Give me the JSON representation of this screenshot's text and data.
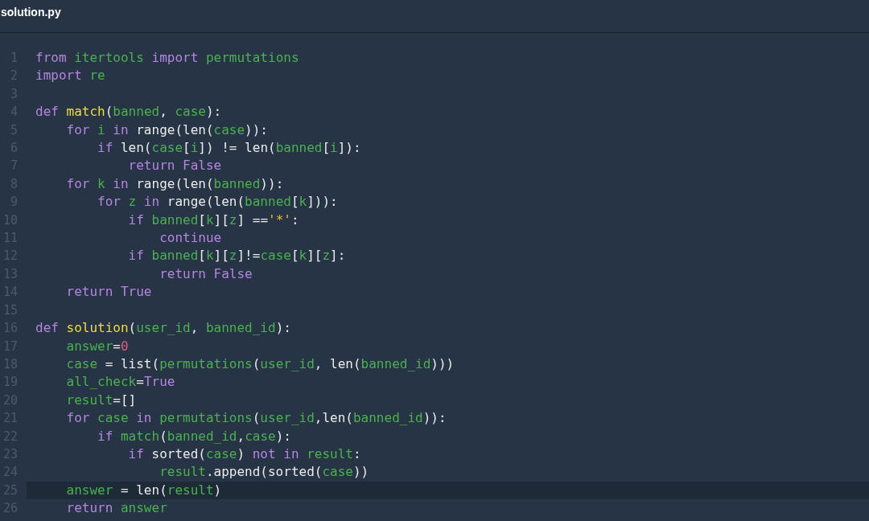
{
  "file": {
    "title": "solution.py"
  },
  "lines": [
    {
      "number": "1",
      "active": false,
      "tokens": [
        {
          "kind": "kw",
          "text": "from "
        },
        {
          "kind": "id",
          "text": "itertools"
        },
        {
          "kind": "kw",
          "text": " import "
        },
        {
          "kind": "id",
          "text": "permutations"
        }
      ]
    },
    {
      "number": "2",
      "active": false,
      "tokens": [
        {
          "kind": "kw",
          "text": "import "
        },
        {
          "kind": "id",
          "text": "re"
        }
      ]
    },
    {
      "number": "3",
      "active": false
    },
    {
      "number": "4",
      "active": false,
      "tokens": [
        {
          "kind": "kw",
          "text": "def "
        },
        {
          "kind": "fn",
          "text": "match"
        },
        {
          "kind": "plain",
          "text": "("
        },
        {
          "kind": "id",
          "text": "banned"
        },
        {
          "kind": "plain",
          "text": ", "
        },
        {
          "kind": "id",
          "text": "case"
        },
        {
          "kind": "plain",
          "text": "):"
        }
      ]
    },
    {
      "number": "5",
      "active": false,
      "tokens": [
        {
          "kind": "kw",
          "text": "    for "
        },
        {
          "kind": "id",
          "text": "i"
        },
        {
          "kind": "kw",
          "text": " in "
        },
        {
          "kind": "plain",
          "text": "range(len("
        },
        {
          "kind": "id",
          "text": "case"
        },
        {
          "kind": "plain",
          "text": ")):"
        }
      ]
    },
    {
      "number": "6",
      "active": false,
      "tokens": [
        {
          "kind": "kw",
          "text": "        if "
        },
        {
          "kind": "plain",
          "text": "len("
        },
        {
          "kind": "id",
          "text": "case"
        },
        {
          "kind": "plain",
          "text": "["
        },
        {
          "kind": "id",
          "text": "i"
        },
        {
          "kind": "plain",
          "text": "]) != len("
        },
        {
          "kind": "id",
          "text": "banned"
        },
        {
          "kind": "plain",
          "text": "["
        },
        {
          "kind": "id",
          "text": "i"
        },
        {
          "kind": "plain",
          "text": "]):"
        }
      ]
    },
    {
      "number": "7",
      "active": false,
      "tokens": [
        {
          "kind": "kw",
          "text": "            return False"
        }
      ]
    },
    {
      "number": "8",
      "active": false,
      "tokens": [
        {
          "kind": "kw",
          "text": "    for "
        },
        {
          "kind": "id",
          "text": "k"
        },
        {
          "kind": "kw",
          "text": " in "
        },
        {
          "kind": "plain",
          "text": "range(len("
        },
        {
          "kind": "id",
          "text": "banned"
        },
        {
          "kind": "plain",
          "text": ")):"
        }
      ]
    },
    {
      "number": "9",
      "active": false,
      "tokens": [
        {
          "kind": "kw",
          "text": "        for "
        },
        {
          "kind": "id",
          "text": "z"
        },
        {
          "kind": "kw",
          "text": " in "
        },
        {
          "kind": "plain",
          "text": "range(len("
        },
        {
          "kind": "id",
          "text": "banned"
        },
        {
          "kind": "plain",
          "text": "["
        },
        {
          "kind": "id",
          "text": "k"
        },
        {
          "kind": "plain",
          "text": "])):"
        }
      ]
    },
    {
      "number": "10",
      "active": false,
      "tokens": [
        {
          "kind": "kw",
          "text": "            if "
        },
        {
          "kind": "id",
          "text": "banned"
        },
        {
          "kind": "plain",
          "text": "["
        },
        {
          "kind": "id",
          "text": "k"
        },
        {
          "kind": "plain",
          "text": "]["
        },
        {
          "kind": "id",
          "text": "z"
        },
        {
          "kind": "plain",
          "text": "] =="
        },
        {
          "kind": "str",
          "text": "'*'"
        },
        {
          "kind": "plain",
          "text": ":"
        }
      ]
    },
    {
      "number": "11",
      "active": false,
      "tokens": [
        {
          "kind": "kw",
          "text": "                continue"
        }
      ]
    },
    {
      "number": "12",
      "active": false,
      "tokens": [
        {
          "kind": "kw",
          "text": "            if "
        },
        {
          "kind": "id",
          "text": "banned"
        },
        {
          "kind": "plain",
          "text": "["
        },
        {
          "kind": "id",
          "text": "k"
        },
        {
          "kind": "plain",
          "text": "]["
        },
        {
          "kind": "id",
          "text": "z"
        },
        {
          "kind": "plain",
          "text": "]!="
        },
        {
          "kind": "id",
          "text": "case"
        },
        {
          "kind": "plain",
          "text": "["
        },
        {
          "kind": "id",
          "text": "k"
        },
        {
          "kind": "plain",
          "text": "]["
        },
        {
          "kind": "id",
          "text": "z"
        },
        {
          "kind": "plain",
          "text": "]:"
        }
      ]
    },
    {
      "number": "13",
      "active": false,
      "tokens": [
        {
          "kind": "kw",
          "text": "                return False"
        }
      ]
    },
    {
      "number": "14",
      "active": false,
      "tokens": [
        {
          "kind": "kw",
          "text": "    return True"
        }
      ]
    },
    {
      "number": "15",
      "active": false
    },
    {
      "number": "16",
      "active": false,
      "tokens": [
        {
          "kind": "kw",
          "text": "def "
        },
        {
          "kind": "fn",
          "text": "solution"
        },
        {
          "kind": "plain",
          "text": "("
        },
        {
          "kind": "id",
          "text": "user_id"
        },
        {
          "kind": "plain",
          "text": ", "
        },
        {
          "kind": "id",
          "text": "banned_id"
        },
        {
          "kind": "plain",
          "text": "):"
        }
      ]
    },
    {
      "number": "17",
      "active": false,
      "tokens": [
        {
          "kind": "id",
          "text": "    answer"
        },
        {
          "kind": "plain",
          "text": "="
        },
        {
          "kind": "num",
          "text": "0"
        }
      ]
    },
    {
      "number": "18",
      "active": false,
      "tokens": [
        {
          "kind": "id",
          "text": "    case"
        },
        {
          "kind": "plain",
          "text": " = list("
        },
        {
          "kind": "id",
          "text": "permutations"
        },
        {
          "kind": "plain",
          "text": "("
        },
        {
          "kind": "id",
          "text": "user_id"
        },
        {
          "kind": "plain",
          "text": ", len("
        },
        {
          "kind": "id",
          "text": "banned_id"
        },
        {
          "kind": "plain",
          "text": ")))"
        }
      ]
    },
    {
      "number": "19",
      "active": false,
      "tokens": [
        {
          "kind": "id",
          "text": "    all_check"
        },
        {
          "kind": "plain",
          "text": "="
        },
        {
          "kind": "kw",
          "text": "True"
        }
      ]
    },
    {
      "number": "20",
      "active": false,
      "tokens": [
        {
          "kind": "id",
          "text": "    result"
        },
        {
          "kind": "plain",
          "text": "=[]"
        }
      ]
    },
    {
      "number": "21",
      "active": false,
      "tokens": [
        {
          "kind": "kw",
          "text": "    for "
        },
        {
          "kind": "id",
          "text": "case"
        },
        {
          "kind": "kw",
          "text": " in "
        },
        {
          "kind": "id",
          "text": "permutations"
        },
        {
          "kind": "plain",
          "text": "("
        },
        {
          "kind": "id",
          "text": "user_id"
        },
        {
          "kind": "plain",
          "text": ",len("
        },
        {
          "kind": "id",
          "text": "banned_id"
        },
        {
          "kind": "plain",
          "text": ")):"
        }
      ]
    },
    {
      "number": "22",
      "active": false,
      "tokens": [
        {
          "kind": "kw",
          "text": "        if "
        },
        {
          "kind": "id",
          "text": "match"
        },
        {
          "kind": "plain",
          "text": "("
        },
        {
          "kind": "id",
          "text": "banned_id"
        },
        {
          "kind": "plain",
          "text": ","
        },
        {
          "kind": "id",
          "text": "case"
        },
        {
          "kind": "plain",
          "text": "):"
        }
      ]
    },
    {
      "number": "23",
      "active": false,
      "tokens": [
        {
          "kind": "kw",
          "text": "            if "
        },
        {
          "kind": "plain",
          "text": "sorted("
        },
        {
          "kind": "id",
          "text": "case"
        },
        {
          "kind": "plain",
          "text": ") "
        },
        {
          "kind": "kw",
          "text": "not in "
        },
        {
          "kind": "id",
          "text": "result"
        },
        {
          "kind": "plain",
          "text": ":"
        }
      ]
    },
    {
      "number": "24",
      "active": false,
      "tokens": [
        {
          "kind": "id",
          "text": "                result"
        },
        {
          "kind": "plain",
          "text": ".append(sorted("
        },
        {
          "kind": "id",
          "text": "case"
        },
        {
          "kind": "plain",
          "text": "))"
        }
      ]
    },
    {
      "number": "25",
      "active": true,
      "tokens": [
        {
          "kind": "id",
          "text": "    answer"
        },
        {
          "kind": "plain",
          "text": " = len("
        },
        {
          "kind": "id",
          "text": "result"
        },
        {
          "kind": "plain",
          "text": ")"
        }
      ]
    },
    {
      "number": "26",
      "active": false,
      "tokens": [
        {
          "kind": "kw",
          "text": "    return "
        },
        {
          "kind": "id",
          "text": "answer"
        }
      ]
    }
  ]
}
